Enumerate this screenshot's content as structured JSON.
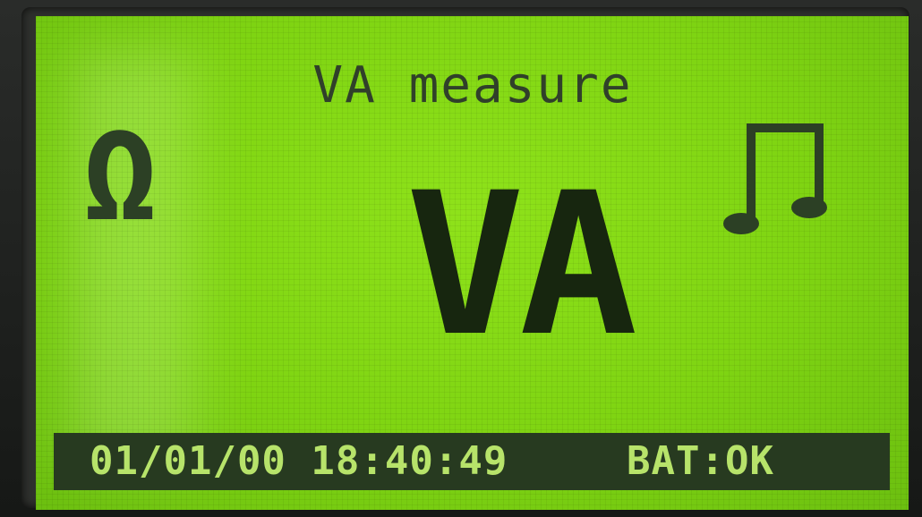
{
  "screen": {
    "title": "VA measure",
    "mode_label": "VA"
  },
  "icons": {
    "left": {
      "name": "omega-icon",
      "glyph": "Ω"
    },
    "right": {
      "name": "music-note-icon"
    }
  },
  "status_bar": {
    "date": "01/01/00",
    "time": "18:40:49",
    "battery": "BAT:OK"
  },
  "colors": {
    "lcd_background": "#7fd412",
    "lcd_text": "#17260f",
    "status_bar_background": "#273a20",
    "status_bar_text": "#b7e36a"
  }
}
